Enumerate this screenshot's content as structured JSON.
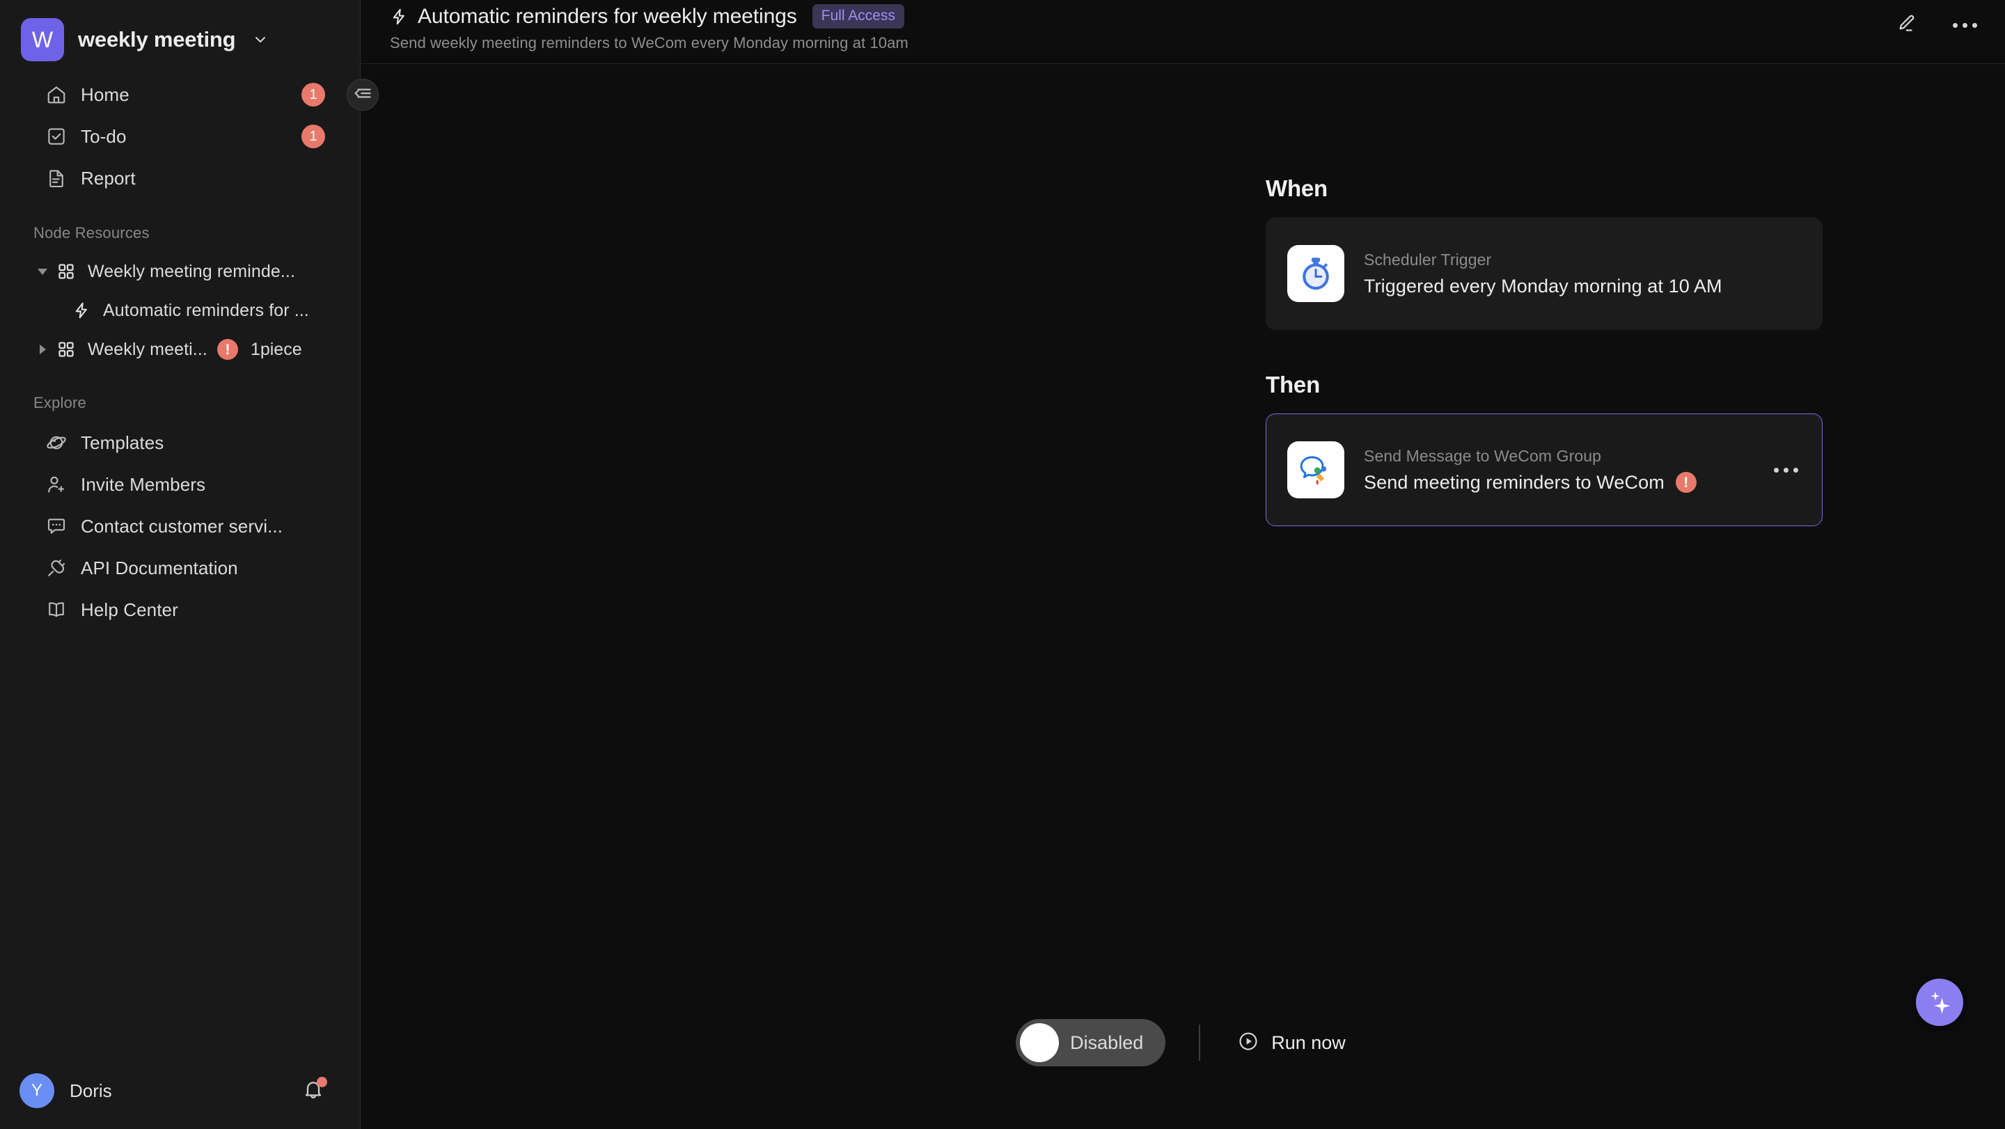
{
  "workspace": {
    "initial": "W",
    "name": "weekly meeting",
    "logo_color": "#6e63e8"
  },
  "sidebar": {
    "nav": [
      {
        "label": "Home",
        "icon": "home-icon",
        "badge": "1"
      },
      {
        "label": "To-do",
        "icon": "checkbox-icon",
        "badge": "1"
      },
      {
        "label": "Report",
        "icon": "document-icon",
        "badge": ""
      }
    ],
    "node_resources": {
      "section_label": "Node Resources",
      "items": [
        {
          "label": "Weekly meeting reminde...",
          "icon": "grid-icon",
          "arrow": "down",
          "error": false,
          "count": ""
        },
        {
          "label": "Automatic reminders for ...",
          "icon": "bolt-icon",
          "arrow": "none",
          "error": false,
          "count": "",
          "child": true,
          "selected": true
        },
        {
          "label": "Weekly meeti...",
          "icon": "grid-icon",
          "arrow": "right",
          "error": true,
          "error_mark": "!",
          "count": "1piece"
        }
      ]
    },
    "explore": {
      "section_label": "Explore",
      "items": [
        {
          "label": "Templates",
          "icon": "planet-icon"
        },
        {
          "label": "Invite Members",
          "icon": "user-plus-icon"
        },
        {
          "label": "Contact customer servi...",
          "icon": "chat-icon"
        },
        {
          "label": "API Documentation",
          "icon": "plug-icon"
        },
        {
          "label": "Help Center",
          "icon": "book-icon"
        }
      ]
    },
    "user": {
      "avatar_initial": "Y",
      "avatar_color": "#6b8ef5",
      "name": "Doris",
      "notification_dot": true
    },
    "collapse_button_icon": "collapse-sidebar-icon"
  },
  "header": {
    "title": "Automatic reminders for weekly meetings",
    "title_icon": "bolt-icon",
    "access_badge": "Full Access",
    "access_badge_color": "#9d8ff5",
    "subtitle": "Send weekly meeting reminders to WeCom every Monday morning at 10am",
    "edit_icon": "pencil-icon",
    "more_icon": "more-horizontal-icon"
  },
  "flow": {
    "when": {
      "heading": "When",
      "node": {
        "kind": "Scheduler Trigger",
        "name": "Triggered every Monday morning at 10 AM",
        "icon": "stopwatch-icon",
        "has_error": false,
        "selected": false
      }
    },
    "then": {
      "heading": "Then",
      "node": {
        "kind": "Send Message to WeCom Group",
        "name": "Send meeting reminders to WeCom",
        "icon": "wecom-icon",
        "has_error": true,
        "error_mark": "!",
        "selected": true,
        "menu_icon": "more-horizontal-icon"
      }
    }
  },
  "bottom_bar": {
    "toggle_label": "Disabled",
    "toggle_state": "off",
    "run_label": "Run now",
    "run_icon": "play-circle-icon"
  },
  "fab": {
    "icon": "sparkle-icon",
    "color": "#8b7ef0"
  }
}
